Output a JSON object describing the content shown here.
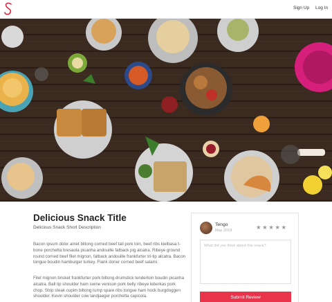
{
  "header": {
    "logo_letter": "S",
    "signup_label": "Sign Up",
    "login_label": "Log In"
  },
  "hero": {
    "image_subject": "food-table-flatlay"
  },
  "main": {
    "title": "Delicious Snack Title",
    "subtitle": "Delicious Snack Short Description",
    "paragraphs": [
      "Bacon ipsum dolor amet biltong corned beef tail pork loin, beef ribs kielbasa t-bone porchetta bresaola picanha andouille fatback pig alcatra. Ribeye ground round corned beef filet mignon, fatback andouille frankfurter tri-tip alcatra. Bacon tongue boudin hamburger turkey. Flank doner corned beef salami.",
      "Filet mignon brisket frankfurter pork biltong drumstick tenderloin boudin picanha alcatra. Ball tip shoulder ham swine venison pork belly ribeye leberkas pork chop. Strip steak cupim biltong rump spare ribs tongue ham hock burgdoggen shoulder. Kevin shoulder cow landjaeger porchetta capicola."
    ]
  },
  "review": {
    "user_name": "Tengo",
    "date": "May 2018",
    "stars": "★★★★★",
    "placeholder": "What did you think about this snack?",
    "submit_label": "Submit Review"
  },
  "colors": {
    "accent": "#e8334a",
    "logo": "#d7263d",
    "table_wood": "#3b2a1f"
  }
}
